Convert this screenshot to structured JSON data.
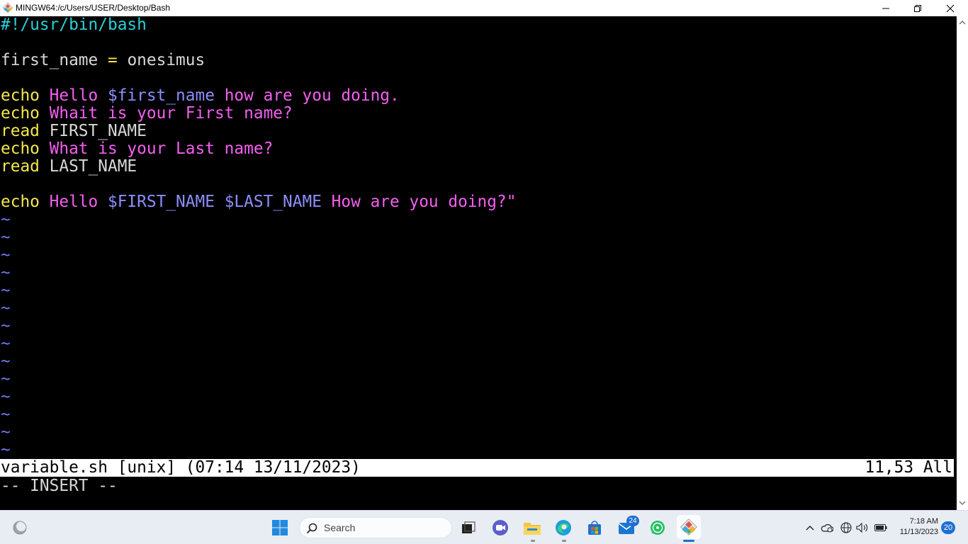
{
  "window": {
    "title": "MINGW64:/c/Users/USER/Desktop/Bash",
    "app_icon": "git-diamond-icon",
    "controls": [
      "minimize-icon",
      "maximize-icon",
      "close-icon"
    ]
  },
  "editor": {
    "lines": [
      [
        {
          "text": "#!/usr/bin/bash",
          "color": "cyan"
        }
      ],
      [],
      [
        {
          "text": "first_name",
          "color": "white"
        },
        {
          "text": " = ",
          "color": "yellow"
        },
        {
          "text": "onesimus",
          "color": "white"
        }
      ],
      [],
      [
        {
          "text": "echo",
          "color": "yellow"
        },
        {
          "text": " Hello ",
          "color": "magenta"
        },
        {
          "text": "$first_name",
          "color": "var"
        },
        {
          "text": " how are you doing.",
          "color": "magenta"
        }
      ],
      [
        {
          "text": "echo",
          "color": "yellow"
        },
        {
          "text": " Whait is your First name?",
          "color": "magenta"
        }
      ],
      [
        {
          "text": "read",
          "color": "yellow"
        },
        {
          "text": " FIRST_NAME",
          "color": "white"
        }
      ],
      [
        {
          "text": "echo",
          "color": "yellow"
        },
        {
          "text": " What is your Last name?",
          "color": "magenta"
        }
      ],
      [
        {
          "text": "read",
          "color": "yellow"
        },
        {
          "text": " LAST_NAME",
          "color": "white"
        }
      ],
      [],
      [
        {
          "text": "echo",
          "color": "yellow"
        },
        {
          "text": " Hello ",
          "color": "magenta"
        },
        {
          "text": "$FIRST_NAME",
          "color": "var"
        },
        {
          "text": " ",
          "color": "magenta"
        },
        {
          "text": "$LAST_NAME",
          "color": "var"
        },
        {
          "text": " How are you doing?\"",
          "color": "magenta"
        }
      ]
    ],
    "empty_line_marker": "~",
    "empty_line_count": 14,
    "status_left": "variable.sh [unix] (07:14 13/11/2023)",
    "status_right": "11,53 All",
    "mode": "-- INSERT --"
  },
  "colors": {
    "cyan": "#2ad1d8",
    "white": "#d8d8d8",
    "yellow": "#f3e84a",
    "magenta": "#f45ff0",
    "var": "#8c8ff9",
    "tilde": "#6f79f6",
    "background": "#000000"
  },
  "taskbar": {
    "search_placeholder": "Search",
    "apps": [
      {
        "name": "task-view-icon"
      },
      {
        "name": "teams-meet-icon"
      },
      {
        "name": "file-explorer-icon",
        "running": true
      },
      {
        "name": "edge-browser-icon",
        "running": true
      },
      {
        "name": "microsoft-store-icon"
      },
      {
        "name": "mail-icon",
        "badge": "24"
      },
      {
        "name": "whatsapp-icon"
      },
      {
        "name": "git-bash-icon",
        "running": true,
        "active": true
      }
    ],
    "tray_icons": [
      "show-hidden-chevron-icon",
      "onedrive-sync-icon",
      "network-globe-icon",
      "volume-icon",
      "battery-icon"
    ],
    "time": "7:18 AM",
    "date": "11/13/2023",
    "notification_count": "20"
  }
}
